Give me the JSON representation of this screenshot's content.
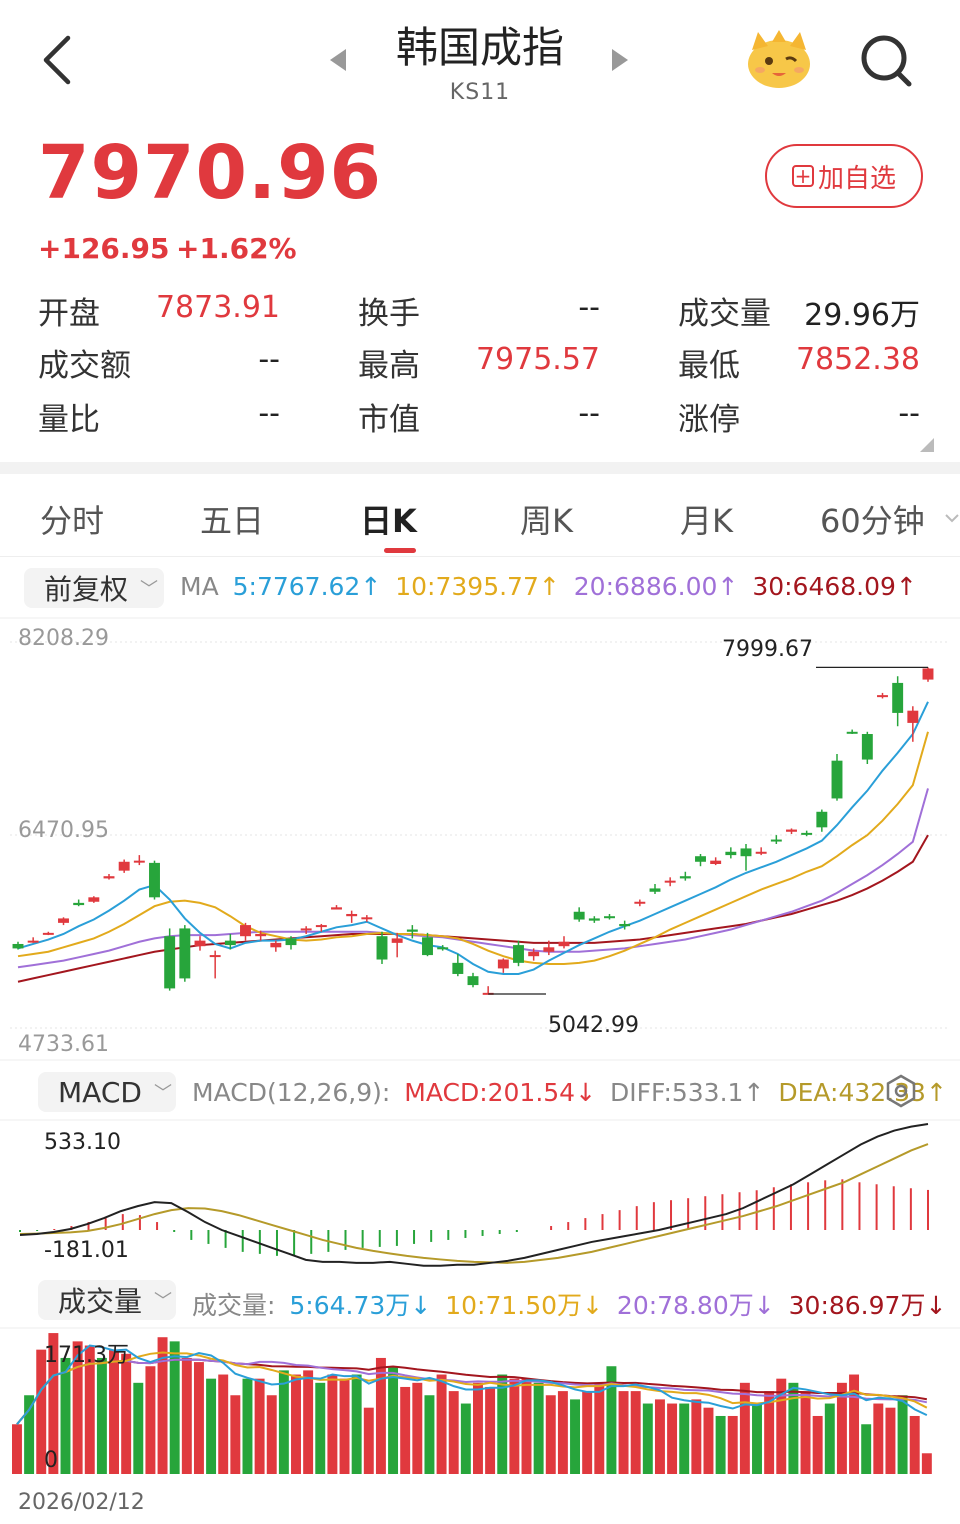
{
  "header": {
    "title": "韩国成指",
    "code": "KS11"
  },
  "quote": {
    "price": "7970.96",
    "change": "+126.95",
    "change_pct": "+1.62%",
    "watch_button": "加自选"
  },
  "stats": [
    {
      "label": "开盘",
      "value": "7873.91",
      "color": "red"
    },
    {
      "label": "换手",
      "value": "--",
      "color": "dark"
    },
    {
      "label": "成交量",
      "value": "29.96万",
      "color": "dark"
    },
    {
      "label": "成交额",
      "value": "--",
      "color": "dark"
    },
    {
      "label": "最高",
      "value": "7975.57",
      "color": "red"
    },
    {
      "label": "最低",
      "value": "7852.38",
      "color": "red"
    },
    {
      "label": "量比",
      "value": "--",
      "color": "dark"
    },
    {
      "label": "市值",
      "value": "--",
      "color": "dark"
    },
    {
      "label": "涨停",
      "value": "--",
      "color": "dark"
    }
  ],
  "tabs": [
    "分时",
    "五日",
    "日K",
    "周K",
    "月K",
    "60分钟"
  ],
  "active_tab": "日K",
  "kline": {
    "adjust_selector": "前复权",
    "ma_label": "MA",
    "ma5": "5:7767.62↑",
    "ma10": "10:7395.77↑",
    "ma20": "20:6886.00↑",
    "ma30": "30:6468.09↑",
    "axis_top": "8208.29",
    "axis_mid": "6470.95",
    "axis_bottom": "4733.61",
    "high_marker": "7999.67",
    "low_marker": "5042.99"
  },
  "macd": {
    "selector": "MACD",
    "params": "MACD(12,26,9):",
    "macd": "MACD:201.54↓",
    "diff": "DIFF:533.1↑",
    "dea": "DEA:432.33↑",
    "axis_top": "533.10",
    "axis_bottom": "-181.01"
  },
  "volume": {
    "selector": "成交量",
    "label": "成交量:",
    "ma5": "5:64.73万↓",
    "ma10": "10:71.50万↓",
    "ma20": "20:78.80万↓",
    "ma30": "30:86.97万↓",
    "axis_top": "171.3万",
    "axis_bottom": "0",
    "start_date": "2026/02/12"
  },
  "colors": {
    "up": "#e0393e",
    "down": "#27a53b",
    "ma5": "#2a9fd8",
    "ma10": "#e2aa1c",
    "ma20": "#a070d8",
    "ma30": "#a3161e"
  },
  "chart_data": {
    "type": "candlestick",
    "ohlc": [
      [
        5490,
        5510,
        5440,
        5450
      ],
      [
        5510,
        5550,
        5500,
        5520
      ],
      [
        5580,
        5600,
        5570,
        5590
      ],
      [
        5680,
        5730,
        5660,
        5720
      ],
      [
        5860,
        5890,
        5830,
        5840
      ],
      [
        5870,
        5920,
        5860,
        5910
      ],
      [
        6080,
        6120,
        6070,
        6100
      ],
      [
        6150,
        6250,
        6130,
        6230
      ],
      [
        6230,
        6290,
        6200,
        6240
      ],
      [
        6220,
        6240,
        5890,
        5910
      ],
      [
        5560,
        5630,
        5070,
        5090
      ],
      [
        5630,
        5660,
        5150,
        5180
      ],
      [
        5470,
        5560,
        5430,
        5520
      ],
      [
        5390,
        5430,
        5180,
        5390
      ],
      [
        5520,
        5580,
        5440,
        5480
      ],
      [
        5560,
        5680,
        5520,
        5660
      ],
      [
        5560,
        5610,
        5520,
        5580
      ],
      [
        5460,
        5520,
        5420,
        5500
      ],
      [
        5540,
        5560,
        5440,
        5480
      ],
      [
        5620,
        5650,
        5580,
        5630
      ],
      [
        5650,
        5670,
        5600,
        5660
      ],
      [
        5800,
        5840,
        5810,
        5820
      ],
      [
        5740,
        5790,
        5680,
        5760
      ],
      [
        5720,
        5750,
        5690,
        5730
      ],
      [
        5560,
        5600,
        5310,
        5350
      ],
      [
        5500,
        5590,
        5370,
        5540
      ],
      [
        5620,
        5660,
        5540,
        5600
      ],
      [
        5550,
        5590,
        5380,
        5390
      ],
      [
        5460,
        5480,
        5430,
        5450
      ],
      [
        5320,
        5400,
        5200,
        5220
      ],
      [
        5200,
        5230,
        5100,
        5120
      ],
      [
        5050,
        5110,
        5040,
        5050
      ],
      [
        5270,
        5360,
        5230,
        5350
      ],
      [
        5480,
        5520,
        5290,
        5320
      ],
      [
        5380,
        5450,
        5340,
        5420
      ],
      [
        5420,
        5520,
        5390,
        5460
      ],
      [
        5470,
        5560,
        5450,
        5510
      ],
      [
        5780,
        5820,
        5690,
        5710
      ],
      [
        5720,
        5740,
        5680,
        5700
      ],
      [
        5740,
        5760,
        5710,
        5730
      ],
      [
        5670,
        5700,
        5620,
        5650
      ],
      [
        5860,
        5890,
        5830,
        5870
      ],
      [
        5990,
        6030,
        5940,
        5960
      ],
      [
        6050,
        6090,
        6010,
        6060
      ],
      [
        6100,
        6140,
        6060,
        6080
      ],
      [
        6280,
        6300,
        6190,
        6230
      ],
      [
        6210,
        6270,
        6200,
        6240
      ],
      [
        6320,
        6360,
        6260,
        6290
      ],
      [
        6350,
        6390,
        6150,
        6280
      ],
      [
        6310,
        6360,
        6290,
        6320
      ],
      [
        6430,
        6470,
        6390,
        6420
      ],
      [
        6500,
        6530,
        6480,
        6520
      ],
      [
        6490,
        6510,
        6460,
        6480
      ],
      [
        6680,
        6700,
        6500,
        6540
      ],
      [
        7140,
        7200,
        6780,
        6800
      ],
      [
        7400,
        7420,
        7380,
        7390
      ],
      [
        7380,
        7400,
        7110,
        7150
      ],
      [
        7720,
        7750,
        7700,
        7730
      ],
      [
        7840,
        7900,
        7450,
        7570
      ],
      [
        7480,
        7630,
        7310,
        7590
      ],
      [
        7870,
        7980,
        7850,
        7970
      ]
    ],
    "ma5": [
      5450,
      5490,
      5530,
      5580,
      5650,
      5710,
      5790,
      5880,
      5980,
      6020,
      5890,
      5720,
      5590,
      5490,
      5450,
      5500,
      5520,
      5520,
      5530,
      5560,
      5600,
      5640,
      5660,
      5690,
      5630,
      5570,
      5520,
      5480,
      5460,
      5400,
      5310,
      5240,
      5220,
      5220,
      5260,
      5340,
      5410,
      5480,
      5540,
      5600,
      5650,
      5700,
      5760,
      5820,
      5880,
      5940,
      6000,
      6070,
      6130,
      6180,
      6230,
      6290,
      6350,
      6420,
      6560,
      6720,
      6870,
      7050,
      7210,
      7380,
      7670
    ],
    "ma10": [
      5380,
      5400,
      5420,
      5460,
      5500,
      5540,
      5600,
      5670,
      5750,
      5830,
      5870,
      5880,
      5860,
      5820,
      5740,
      5650,
      5590,
      5560,
      5530,
      5520,
      5530,
      5550,
      5560,
      5580,
      5590,
      5580,
      5580,
      5570,
      5560,
      5540,
      5490,
      5430,
      5380,
      5340,
      5320,
      5310,
      5310,
      5320,
      5340,
      5380,
      5430,
      5490,
      5550,
      5620,
      5680,
      5740,
      5800,
      5860,
      5920,
      5980,
      6030,
      6080,
      6140,
      6190,
      6280,
      6380,
      6470,
      6600,
      6750,
      6920,
      7400
    ],
    "ma20": [
      5280,
      5300,
      5320,
      5340,
      5370,
      5400,
      5430,
      5470,
      5510,
      5540,
      5560,
      5570,
      5570,
      5570,
      5580,
      5590,
      5600,
      5600,
      5600,
      5600,
      5600,
      5600,
      5600,
      5600,
      5590,
      5580,
      5570,
      5560,
      5550,
      5530,
      5510,
      5490,
      5470,
      5450,
      5430,
      5420,
      5420,
      5420,
      5430,
      5440,
      5450,
      5470,
      5490,
      5510,
      5530,
      5560,
      5590,
      5620,
      5660,
      5700,
      5740,
      5780,
      5830,
      5880,
      5950,
      6030,
      6110,
      6200,
      6300,
      6410,
      6890
    ],
    "ma30": [
      5150,
      5180,
      5210,
      5240,
      5270,
      5300,
      5330,
      5360,
      5390,
      5420,
      5440,
      5460,
      5480,
      5490,
      5500,
      5510,
      5520,
      5530,
      5540,
      5550,
      5560,
      5570,
      5580,
      5580,
      5580,
      5580,
      5580,
      5570,
      5560,
      5550,
      5540,
      5530,
      5520,
      5510,
      5500,
      5500,
      5500,
      5500,
      5500,
      5510,
      5520,
      5530,
      5550,
      5570,
      5590,
      5610,
      5630,
      5650,
      5670,
      5700,
      5730,
      5760,
      5800,
      5840,
      5880,
      5930,
      5990,
      6060,
      6140,
      6230,
      6470
    ],
    "volume": [
      60,
      95,
      150,
      170,
      140,
      160,
      155,
      140,
      150,
      145,
      110,
      130,
      165,
      160,
      140,
      135,
      115,
      120,
      95,
      115,
      115,
      95,
      125,
      120,
      125,
      110,
      120,
      115,
      120,
      80,
      140,
      130,
      105,
      110,
      95,
      120,
      100,
      85,
      110,
      105,
      120,
      115,
      115,
      110,
      95,
      100,
      90,
      100,
      110,
      130,
      100,
      100,
      85,
      90,
      85,
      85,
      90,
      80,
      70,
      70,
      110,
      85,
      100,
      115,
      110,
      100,
      70,
      85,
      110,
      120,
      60,
      85,
      80,
      95,
      70,
      25
    ],
    "macd_diff": [
      -25,
      -20,
      -10,
      5,
      30,
      60,
      95,
      120,
      140,
      135,
      90,
      40,
      0,
      -30,
      -60,
      -90,
      -120,
      -150,
      -160,
      -160,
      -165,
      -165,
      -160,
      -170,
      -180,
      -180,
      -175,
      -175,
      -165,
      -155,
      -140,
      -120,
      -100,
      -80,
      -60,
      -45,
      -30,
      -15,
      0,
      20,
      40,
      60,
      80,
      110,
      150,
      190,
      230,
      280,
      330,
      380,
      430,
      470,
      500,
      520,
      533
    ],
    "macd_dea": [
      -20,
      -18,
      -15,
      -12,
      -5,
      10,
      30,
      55,
      80,
      100,
      110,
      108,
      95,
      75,
      50,
      25,
      0,
      -25,
      -50,
      -70,
      -90,
      -105,
      -118,
      -130,
      -140,
      -148,
      -155,
      -160,
      -163,
      -165,
      -160,
      -150,
      -140,
      -125,
      -110,
      -90,
      -70,
      -50,
      -30,
      -10,
      10,
      30,
      50,
      70,
      95,
      120,
      150,
      180,
      210,
      240,
      280,
      320,
      360,
      400,
      432
    ],
    "macd_hist": [
      -10,
      -5,
      5,
      20,
      40,
      60,
      80,
      75,
      40,
      -10,
      -50,
      -70,
      -90,
      -110,
      -120,
      -130,
      -130,
      -120,
      -110,
      -100,
      -90,
      -85,
      -80,
      -70,
      -60,
      -50,
      -40,
      -30,
      -20,
      -10,
      0,
      20,
      40,
      60,
      80,
      100,
      120,
      140,
      150,
      160,
      170,
      180,
      190,
      200,
      215,
      230,
      240,
      250,
      255,
      240,
      230,
      220,
      210,
      201.54
    ],
    "y_range": [
      4733.61,
      8208.29
    ],
    "macd_range": [
      -181.01,
      533.1
    ],
    "volume_range": [
      0,
      171.3
    ]
  }
}
